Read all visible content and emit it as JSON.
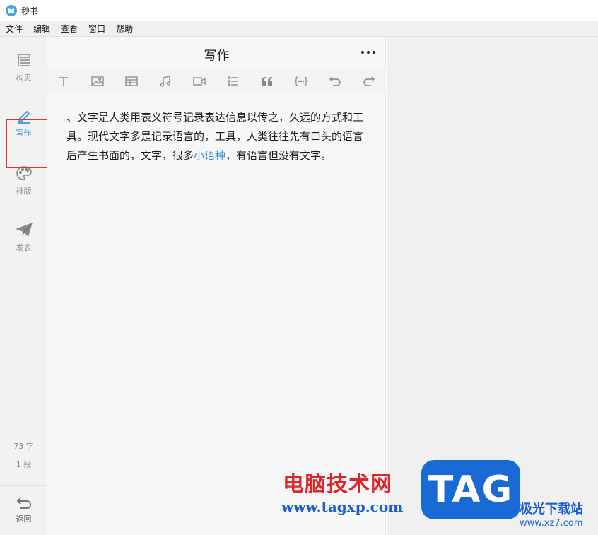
{
  "window": {
    "title": "秒书"
  },
  "menu": [
    "文件",
    "编辑",
    "查看",
    "窗口",
    "帮助"
  ],
  "sidebar": {
    "items": [
      {
        "label": "构思",
        "icon": "outline-icon"
      },
      {
        "label": "写作",
        "icon": "pen-icon",
        "active": true
      },
      {
        "label": "排版",
        "icon": "palette-icon"
      },
      {
        "label": "发表",
        "icon": "paper-plane-icon"
      }
    ],
    "word_count": "73 字",
    "paragraph_count": "1 段",
    "back_label": "返回"
  },
  "editor": {
    "title": "写作",
    "toolbar": [
      "text-icon",
      "image-icon",
      "table-icon",
      "music-icon",
      "video-icon",
      "list-icon",
      "quote-icon",
      "code-icon",
      "undo-icon",
      "redo-icon"
    ],
    "paragraph_before_link": "、文字是人类用表义符号记录表达信息以传之，久远的方式和工具。现代文字多是记录语言的，工具，人类往往先有口头的语言后产生书面的，文字，很多",
    "paragraph_link": "小语种",
    "paragraph_after_link": "，有语言但没有文字。"
  },
  "watermark": {
    "left_title": "电脑技术网",
    "left_url": "www.tagxp.com",
    "badge": "TAG",
    "right_title": "极光下载站",
    "right_url": "www.xz7.com"
  },
  "colors": {
    "accent": "#3a8fd9",
    "highlight": "#e03131"
  }
}
